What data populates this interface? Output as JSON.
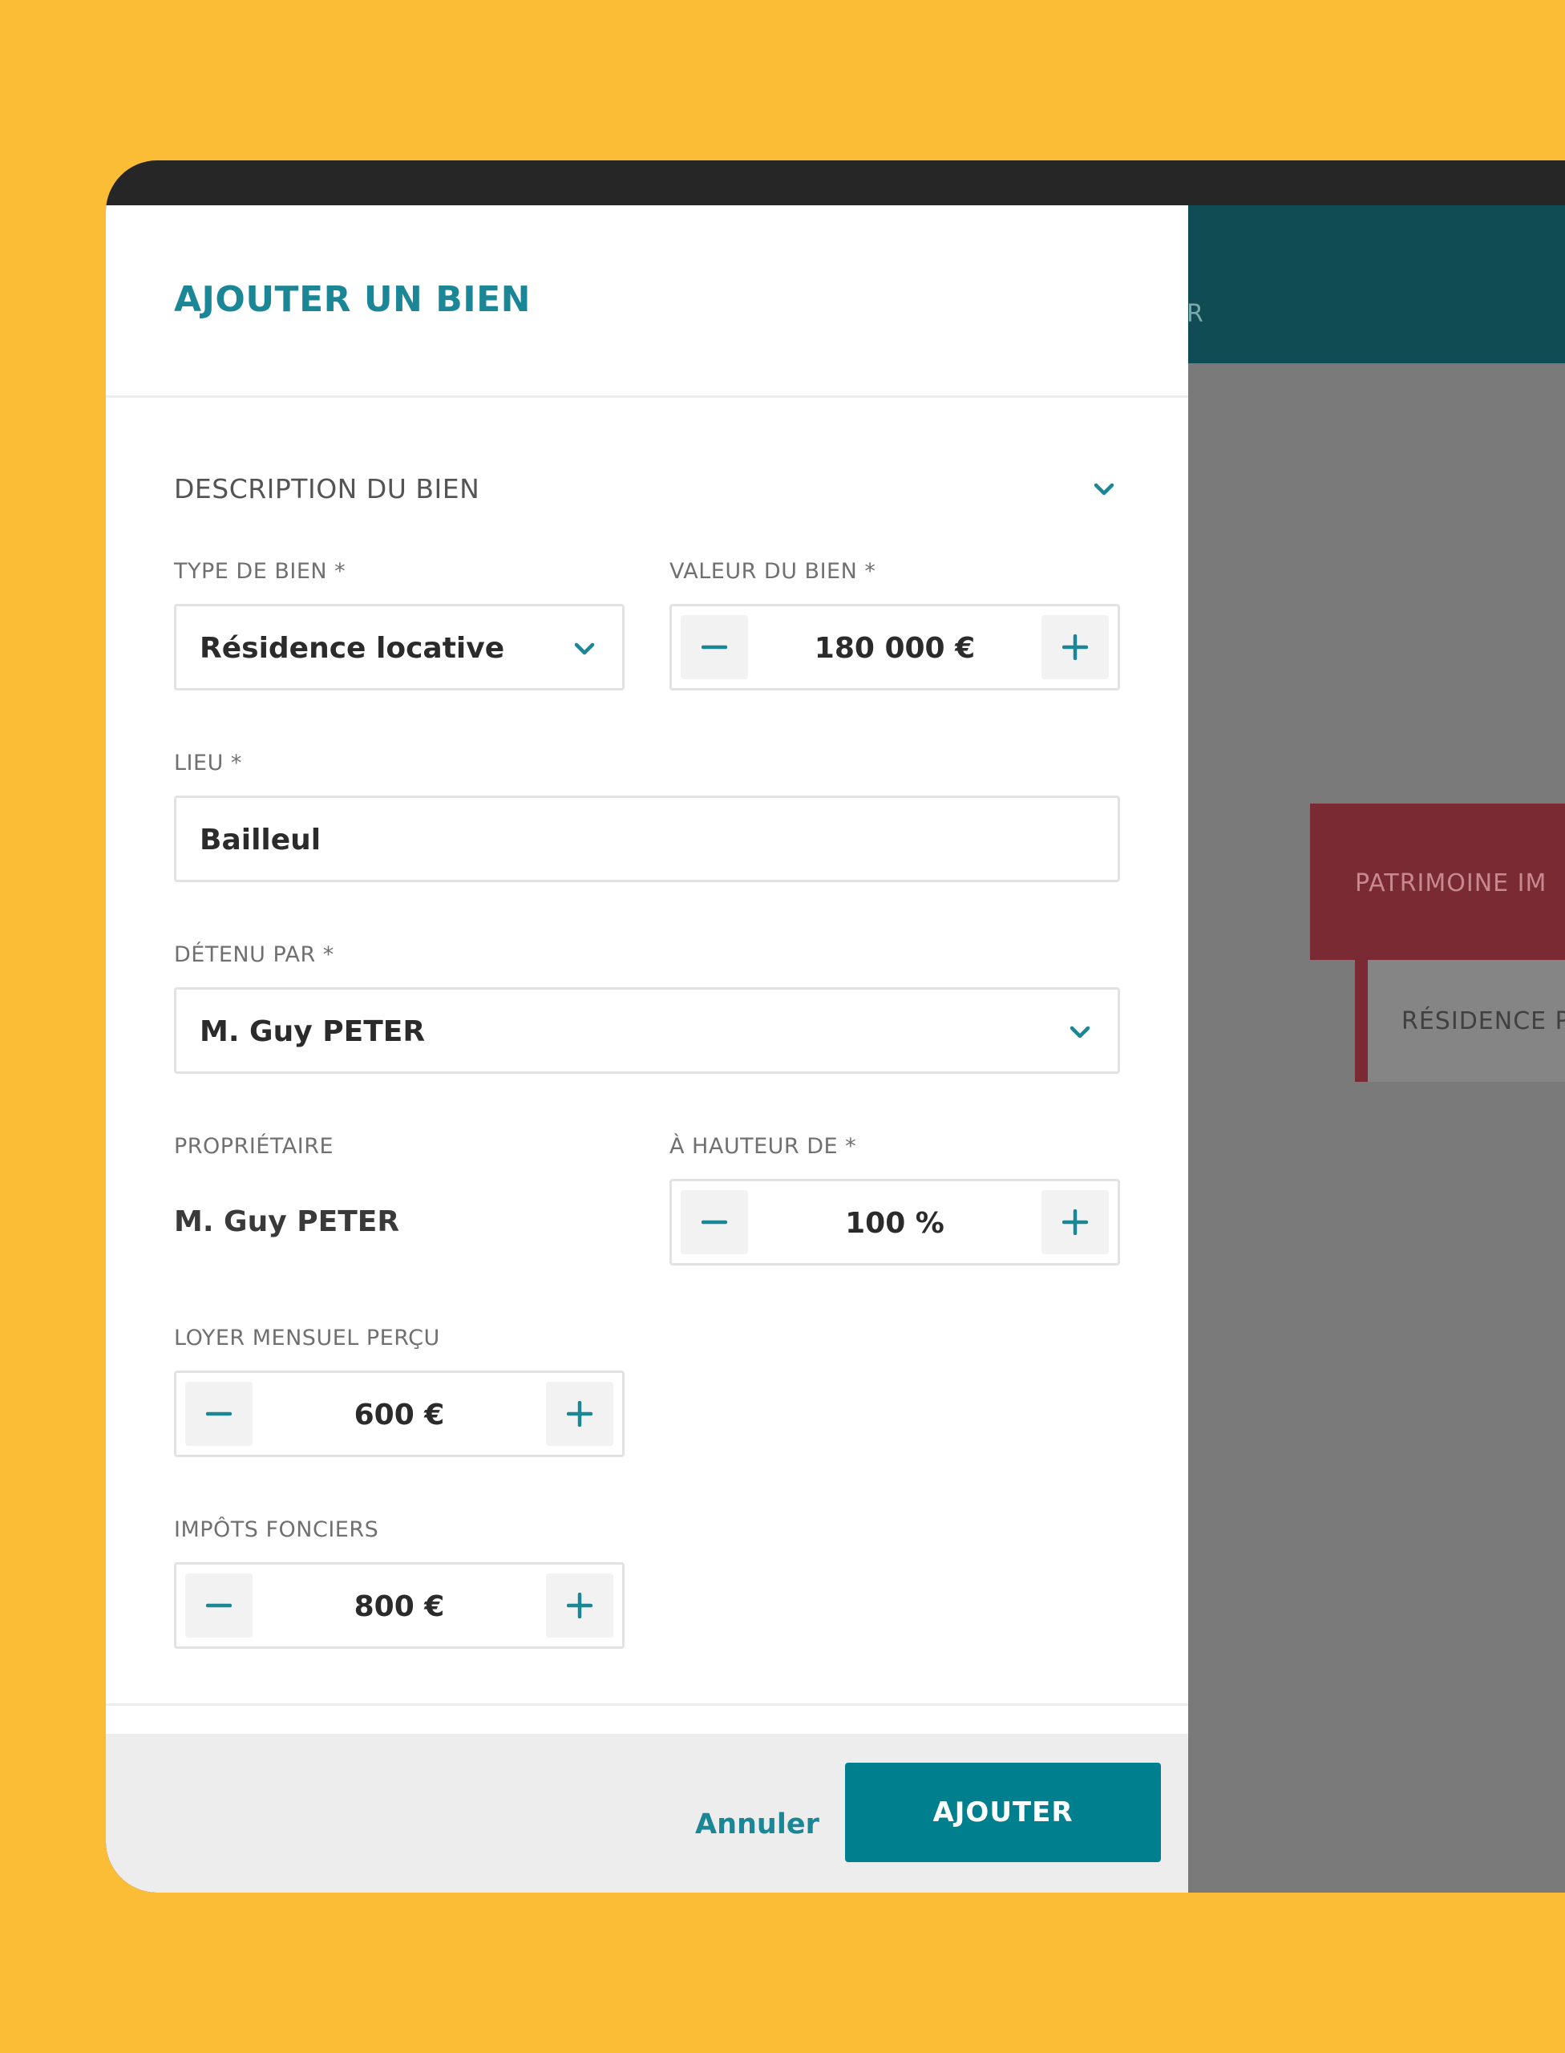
{
  "colors": {
    "page_background": "#FBBD36",
    "accent": "#00808F",
    "accent_text": "#1B8796",
    "header_background": "#104C53",
    "overlay": "#7A7A7A",
    "card_red": "#7A2A33"
  },
  "background": {
    "header_hint": "R",
    "card_title": "PATRIMOINE IM",
    "row_title": "RÉSIDENCE P"
  },
  "modal": {
    "title": "AJOUTER UN BIEN",
    "section": {
      "title": "DESCRIPTION DU BIEN",
      "icon": "chevron-down-icon"
    },
    "fields": {
      "type_de_bien": {
        "label": "TYPE DE BIEN *",
        "value": "Résidence locative",
        "icon": "chevron-down-icon"
      },
      "valeur_du_bien": {
        "label": "VALEUR DU BIEN *",
        "value": "180 000 €"
      },
      "lieu": {
        "label": "LIEU *",
        "value": "Bailleul"
      },
      "detenu_par": {
        "label": "DÉTENU PAR *",
        "value": "M. Guy PETER",
        "icon": "chevron-down-icon"
      },
      "proprietaire": {
        "label": "PROPRIÉTAIRE",
        "value": "M. Guy PETER"
      },
      "a_hauteur_de": {
        "label": "À HAUTEUR DE *",
        "value": "100 %"
      },
      "loyer_mensuel": {
        "label": "LOYER MENSUEL PERÇU",
        "value": "600 €"
      },
      "impots_fonciers": {
        "label": "IMPÔTS FONCIERS",
        "value": "800 €"
      }
    },
    "footer": {
      "cancel_label": "Annuler",
      "submit_label": "AJOUTER"
    }
  }
}
